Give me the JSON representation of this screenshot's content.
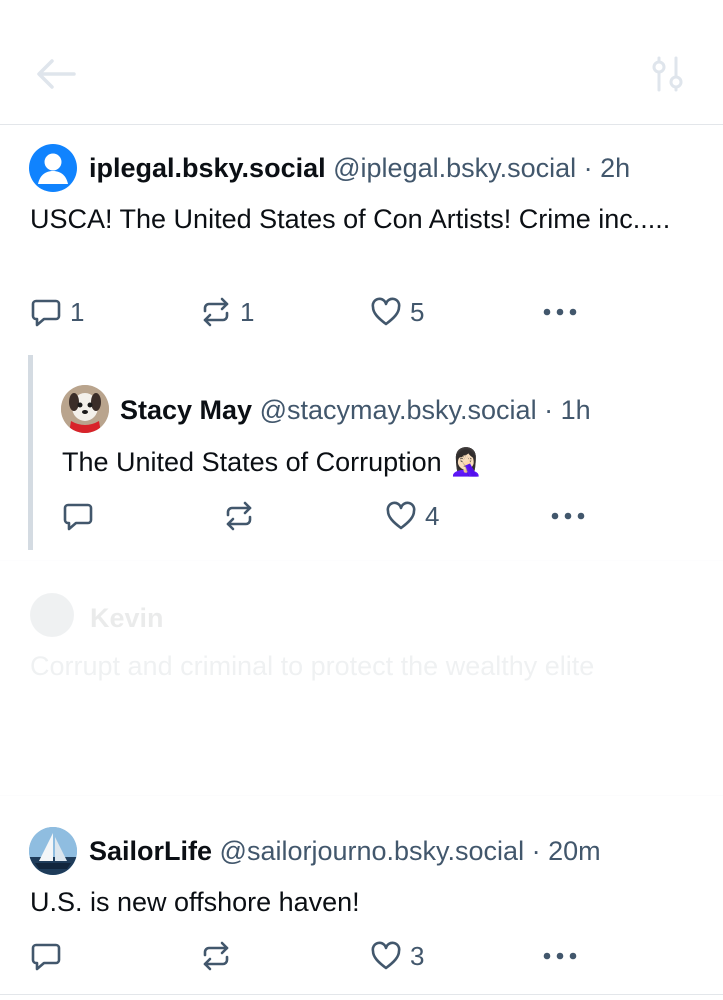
{
  "post1": {
    "display_name": "iplegal.bsky.social",
    "handle": "@iplegal.bsky.social",
    "time": "· 2h",
    "text": "USCA! The United States of Con Artists! Crime inc.....",
    "replies": "1",
    "reposts": "1",
    "likes": "5"
  },
  "quote": {
    "display_name": "Stacy May",
    "handle": "@stacymay.bsky.social",
    "time": "· 1h",
    "text": "The United States of Corruption 🤦🏻‍♀️",
    "replies": "",
    "reposts": "",
    "likes": "4"
  },
  "ghost_post": {
    "display_name": "Kevin",
    "text": "Corrupt and criminal to protect the wealthy elite"
  },
  "post3": {
    "display_name": "SailorLife",
    "handle": "@sailorjourno.bsky.social",
    "time": "· 20m",
    "text": "U.S. is new offshore haven!",
    "replies": "",
    "reposts": "",
    "likes": "3"
  },
  "colors": {
    "accent": "#1083fe",
    "muted": "#42576c",
    "border": "#e3e6ea"
  },
  "icons": [
    "back-arrow-icon",
    "filter-sliders-icon",
    "reply-icon",
    "repost-icon",
    "heart-icon",
    "more-icon"
  ]
}
